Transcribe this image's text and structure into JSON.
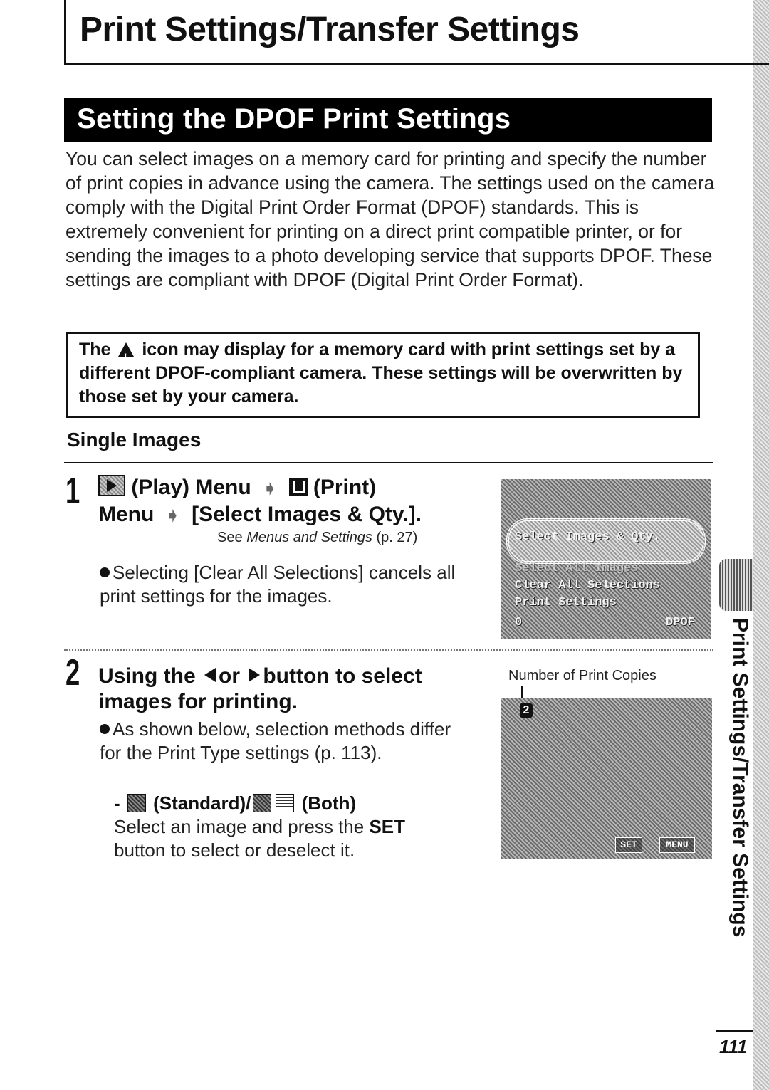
{
  "chapter": {
    "title": "Print Settings/Transfer Settings"
  },
  "section": {
    "title": "Setting the DPOF Print Settings"
  },
  "intro": "You can select images on a memory card for printing and specify the number of print copies in advance using the camera. The settings used on the camera comply with the Digital Print Order Format (DPOF) standards. This is extremely convenient for printing on a direct print compatible printer, or for sending the images to a photo developing service that supports DPOF. These settings are compliant with DPOF (Digital Print Order Format).",
  "note": {
    "before_icon": "The",
    "icon": "warning-triangle-icon",
    "after_icon": "icon may display for a memory card with print settings set by a different DPOF-compliant camera. These settings will be overwritten by those set by your camera."
  },
  "subheading": "Single Images",
  "step1": {
    "number": "1",
    "play_label": "(Play) Menu",
    "print_label": "(Print)",
    "line2_menu": "Menu",
    "line2_item": "[Select Images & Qty.].",
    "ref_see": "See",
    "ref_title": "Menus and Settings",
    "ref_page": "(p. 27)",
    "bullet": "Selecting [Clear All Selections] cancels all print settings for the images.",
    "screen": {
      "items": [
        "Select Images & Qty.",
        "Select All Images",
        "Clear All Selections",
        "Print Settings"
      ],
      "footer_left": "0",
      "footer_right": "DPOF"
    }
  },
  "step2": {
    "number": "2",
    "title_a": "Using the",
    "title_or": "or",
    "title_b": "button to select images for printing.",
    "bullet": "As shown below, selection methods differ for the Print Type settings (p. 113).",
    "sub_dash": "-",
    "sub_standard": "(Standard)/",
    "sub_both": "(Both)",
    "sub_text_a": "Select an image and press the",
    "sub_set": "SET",
    "sub_text_b": "button to select or deselect it.",
    "caption": "Number of Print Copies",
    "screen": {
      "copies": "2",
      "btn_set": "SET",
      "btn_menu": "MENU"
    }
  },
  "side_tab": {
    "label": "Print Settings/Transfer Settings"
  },
  "page_number": "111"
}
